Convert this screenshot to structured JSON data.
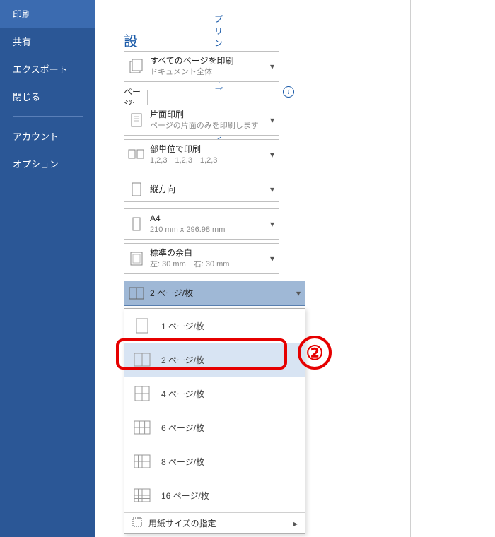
{
  "sidebar": {
    "items": [
      {
        "label": "印刷",
        "active": true
      },
      {
        "label": "共有"
      },
      {
        "label": "エクスポート"
      },
      {
        "label": "閉じる"
      }
    ],
    "items2": [
      {
        "label": "アカウント"
      },
      {
        "label": "オプション"
      }
    ]
  },
  "printerPropsLink": "プリンターのプロパティ",
  "sectionTitle": "設定",
  "pagesLabel": "ページ:",
  "pagesValue": "",
  "settings": {
    "allPages": {
      "t1": "すべてのページを印刷",
      "t2": "ドキュメント全体"
    },
    "oneside": {
      "t1": "片面印刷",
      "t2": "ページの片面のみを印刷します"
    },
    "collate": {
      "t1": "部単位で印刷",
      "t2": "1,2,3　1,2,3　1,2,3"
    },
    "orientation": {
      "t1": "縦方向"
    },
    "paper": {
      "t1": "A4",
      "t2": "210 mm x 296.98 mm"
    },
    "margin": {
      "t1": "標準の余白",
      "t2": "左: 30 mm　右: 30 mm"
    },
    "perSheet": {
      "t1": "2 ページ/枚"
    }
  },
  "dropdown": {
    "items": [
      {
        "label": "1 ページ/枚"
      },
      {
        "label": "2 ページ/枚",
        "highlight": true
      },
      {
        "label": "4 ページ/枚"
      },
      {
        "label": "6 ページ/枚"
      },
      {
        "label": "8 ページ/枚"
      },
      {
        "label": "16 ページ/枚"
      }
    ],
    "footer": "用紙サイズの指定"
  },
  "annotation": "②"
}
